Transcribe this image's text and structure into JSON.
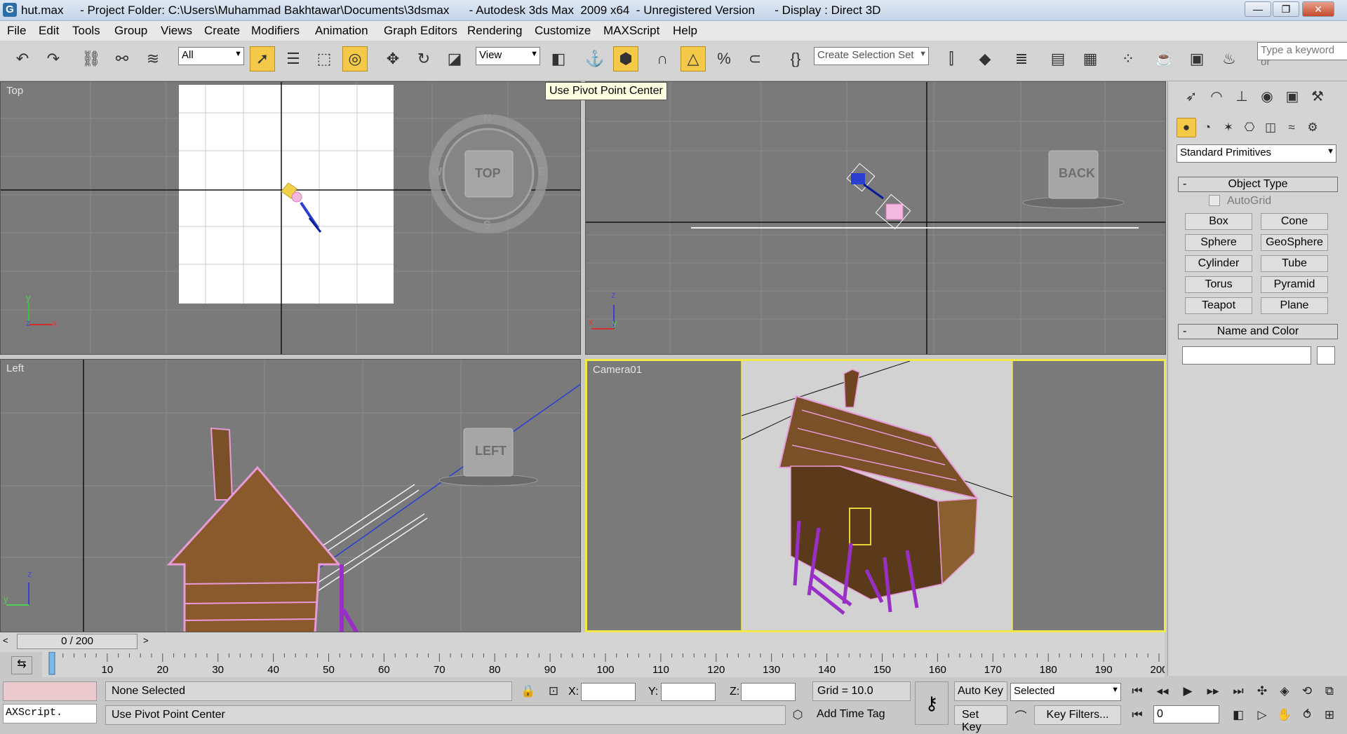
{
  "window": {
    "title": "hut.max     - Project Folder: C:\\Users\\Muhammad Bakhtawar\\Documents\\3dsmax      - Autodesk 3ds Max  2009 x64  - Unregistered Version      - Display : Direct 3D",
    "minimize": "—",
    "restore": "❐",
    "close": "✕"
  },
  "menu": [
    "File",
    "Edit",
    "Tools",
    "Group",
    "Views",
    "Create",
    "Modifiers",
    "Animation",
    "Graph Editors",
    "Rendering",
    "Customize",
    "MAXScript",
    "Help"
  ],
  "toolbar": {
    "filter_value": "All",
    "coord_value": "View",
    "selection_set_placeholder": "Create Selection Set",
    "search_placeholder": "Type a keyword or",
    "tooltip": "Use Pivot Point Center"
  },
  "viewports": {
    "top": {
      "label": "Top",
      "nav_cube": "TOP",
      "compass": [
        "N",
        "S",
        "E",
        "W"
      ]
    },
    "back": {
      "label": "",
      "nav_cube": "BACK"
    },
    "left": {
      "label": "Left",
      "nav_cube": "LEFT"
    },
    "camera": {
      "label": "Camera01"
    }
  },
  "axes": {
    "x": "x",
    "y": "y",
    "z": "z"
  },
  "command_panel": {
    "category": "Standard Primitives",
    "object_type_title": "Object Type",
    "autogrid": "AutoGrid",
    "primitives": [
      "Box",
      "Cone",
      "Sphere",
      "GeoSphere",
      "Cylinder",
      "Tube",
      "Torus",
      "Pyramid",
      "Teapot",
      "Plane"
    ],
    "name_color_title": "Name and Color",
    "name_value": "",
    "collapse": "-"
  },
  "timeline": {
    "frame": "0 / 200",
    "ticks": [
      10,
      20,
      30,
      40,
      50,
      60,
      70,
      80,
      90,
      100,
      110,
      120,
      130,
      140,
      150,
      160,
      170,
      180,
      190,
      200
    ],
    "current_frame": 0,
    "total_frames": 200
  },
  "status": {
    "selection": "None Selected",
    "prompt": "Use Pivot Point Center",
    "maxscript": "AXScript.",
    "x_label": "X:",
    "y_label": "Y:",
    "z_label": "Z:",
    "grid": "Grid = 10.0",
    "add_time_tag": "Add Time Tag",
    "auto_key": "Auto Key",
    "set_key": "Set Key",
    "key_mode": "Selected",
    "key_filters": "Key Filters...",
    "frame_field": "0"
  }
}
